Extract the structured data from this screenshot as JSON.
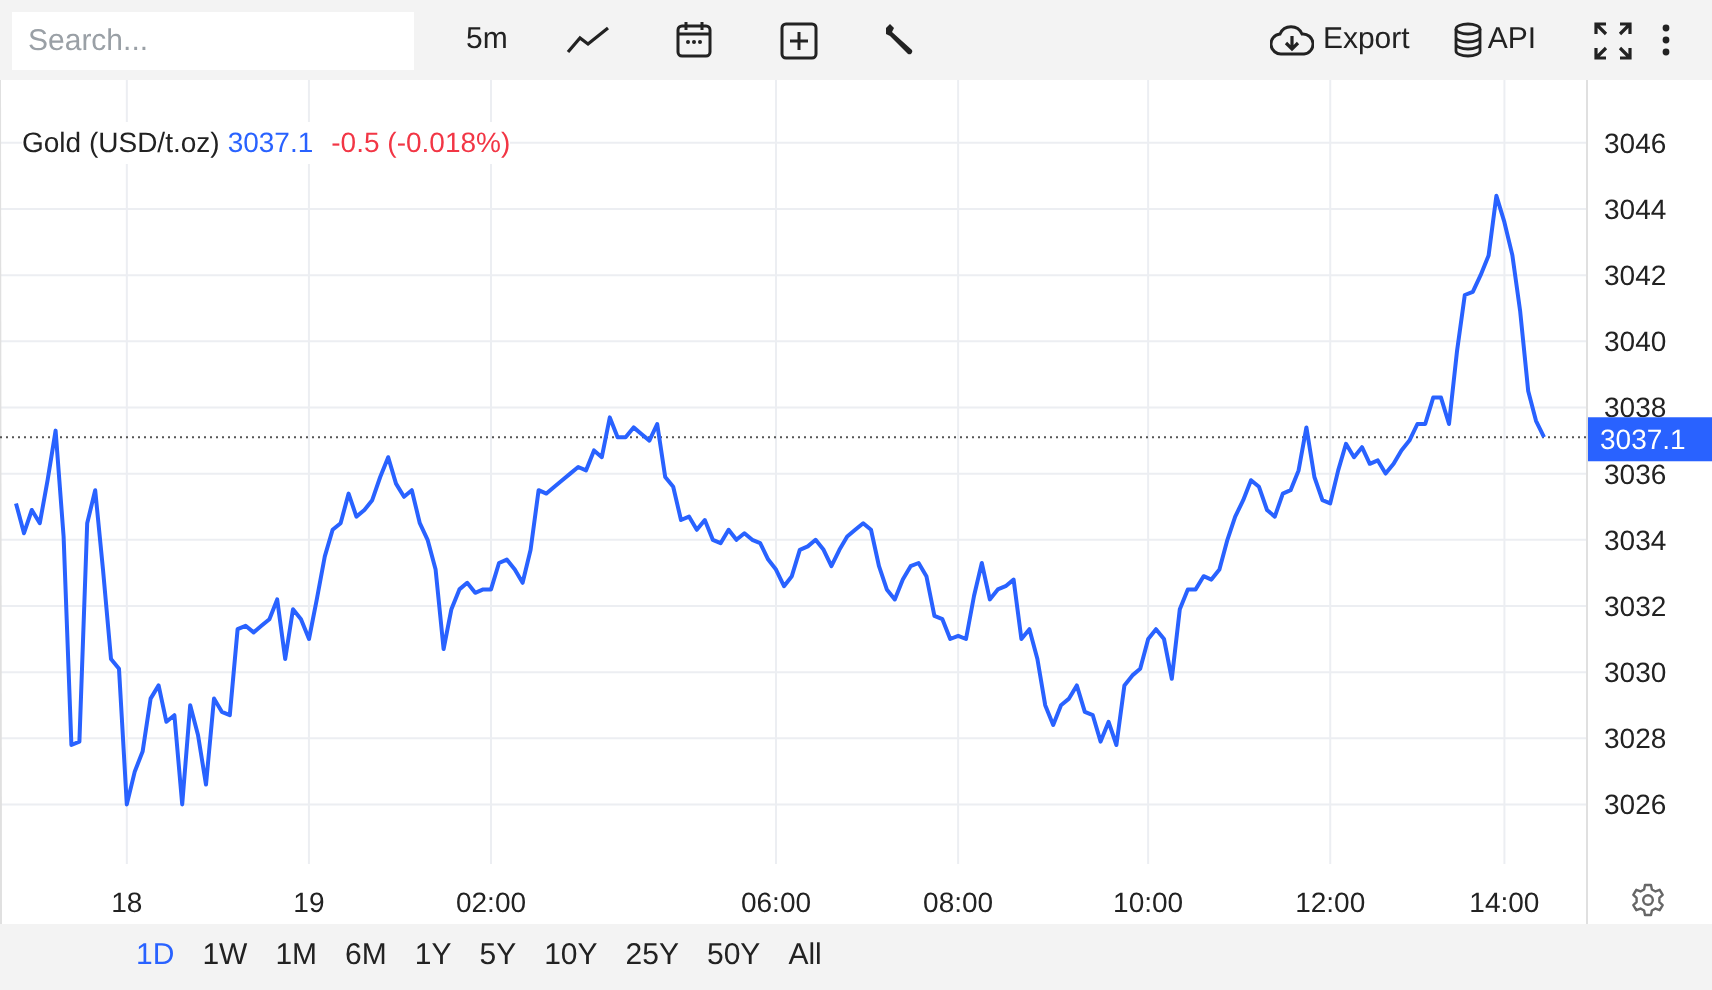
{
  "toolbar": {
    "search": {
      "placeholder": "Search..."
    },
    "interval": "5m",
    "export": "Export",
    "api": "API"
  },
  "chart": {
    "legend": {
      "price": "3037.1",
      "change": "-0.5 (-0.018%)"
    },
    "last_price": {
      "label": "3037.1"
    },
    "chart_data": {
      "type": "line",
      "grid": true,
      "categories": [
        null,
        null,
        null,
        null,
        null,
        null,
        null,
        null,
        null,
        null,
        null,
        null,
        null,
        null,
        "18",
        null,
        null,
        null,
        null,
        null,
        null,
        null,
        null,
        null,
        null,
        null,
        null,
        null,
        null,
        null,
        null,
        null,
        null,
        null,
        null,
        null,
        null,
        "19",
        null,
        null,
        null,
        null,
        null,
        null,
        null,
        null,
        null,
        null,
        null,
        null,
        null,
        null,
        null,
        null,
        null,
        null,
        null,
        null,
        null,
        null,
        "02:00",
        null,
        null,
        null,
        null,
        null,
        null,
        null,
        null,
        null,
        null,
        null,
        null,
        null,
        null,
        null,
        null,
        null,
        null,
        null,
        null,
        null,
        null,
        null,
        null,
        null,
        null,
        null,
        null,
        null,
        null,
        null,
        null,
        null,
        null,
        null,
        "06:00",
        null,
        null,
        null,
        null,
        null,
        null,
        null,
        null,
        null,
        null,
        null,
        null,
        null,
        null,
        null,
        null,
        null,
        null,
        null,
        null,
        null,
        null,
        "08:00",
        null,
        null,
        null,
        null,
        null,
        null,
        null,
        null,
        null,
        null,
        null,
        null,
        null,
        null,
        null,
        null,
        null,
        null,
        null,
        null,
        null,
        null,
        null,
        "10:00",
        null,
        null,
        null,
        null,
        null,
        null,
        null,
        null,
        null,
        null,
        null,
        null,
        null,
        null,
        null,
        null,
        null,
        null,
        null,
        null,
        null,
        null,
        "12:00",
        null,
        null,
        null,
        null,
        null,
        null,
        null,
        null,
        null,
        null,
        null,
        null,
        null,
        null,
        null,
        null,
        null,
        null,
        null,
        null,
        null,
        "14:00",
        null,
        null,
        null,
        null,
        null
      ],
      "ref_lines": [
        {
          "axis": "y",
          "value": 3037.1,
          "color": "#555555"
        }
      ],
      "series": [
        {
          "name": "Gold (USD/t.oz)",
          "color": "#2962ff",
          "values": [
            3035.1,
            3034.2,
            3034.9,
            3034.5,
            3035.8,
            3037.3,
            3034.1,
            3027.8,
            3027.9,
            3034.5,
            3035.5,
            3033.1,
            3030.4,
            3030.1,
            3026.0,
            3027.0,
            3027.6,
            3029.2,
            3029.6,
            3028.5,
            3028.7,
            3026.0,
            3029.0,
            3028.1,
            3026.6,
            3029.2,
            3028.8,
            3028.7,
            3031.3,
            3031.4,
            3031.2,
            3031.4,
            3031.6,
            3032.2,
            3030.4,
            3031.9,
            3031.6,
            3031.0,
            3032.2,
            3033.5,
            3034.3,
            3034.5,
            3035.4,
            3034.7,
            3034.9,
            3035.2,
            3035.9,
            3036.5,
            3035.7,
            3035.3,
            3035.5,
            3034.5,
            3034.0,
            3033.1,
            3030.7,
            3031.9,
            3032.5,
            3032.7,
            3032.4,
            3032.5,
            3032.5,
            3033.3,
            3033.4,
            3033.1,
            3032.7,
            3033.7,
            3035.5,
            3035.4,
            3035.6,
            3035.8,
            3036.0,
            3036.2,
            3036.1,
            3036.7,
            3036.5,
            3037.7,
            3037.1,
            3037.1,
            3037.4,
            3037.2,
            3037.0,
            3037.5,
            3035.9,
            3035.6,
            3034.6,
            3034.7,
            3034.3,
            3034.6,
            3034.0,
            3033.9,
            3034.3,
            3034.0,
            3034.2,
            3034.0,
            3033.9,
            3033.4,
            3033.1,
            3032.6,
            3032.9,
            3033.7,
            3033.8,
            3034.0,
            3033.7,
            3033.2,
            3033.7,
            3034.1,
            3034.3,
            3034.5,
            3034.3,
            3033.2,
            3032.5,
            3032.2,
            3032.8,
            3033.2,
            3033.3,
            3032.9,
            3031.7,
            3031.6,
            3031.0,
            3031.1,
            3031.0,
            3032.3,
            3033.3,
            3032.2,
            3032.5,
            3032.6,
            3032.8,
            3031.0,
            3031.3,
            3030.4,
            3029.0,
            3028.4,
            3029.0,
            3029.2,
            3029.6,
            3028.8,
            3028.7,
            3027.9,
            3028.5,
            3027.8,
            3029.6,
            3029.9,
            3030.1,
            3031.0,
            3031.3,
            3031.0,
            3029.8,
            3031.9,
            3032.5,
            3032.5,
            3032.9,
            3032.8,
            3033.1,
            3034.0,
            3034.7,
            3035.2,
            3035.8,
            3035.6,
            3034.9,
            3034.7,
            3035.4,
            3035.5,
            3036.1,
            3037.4,
            3035.9,
            3035.2,
            3035.1,
            3036.1,
            3036.9,
            3036.5,
            3036.8,
            3036.3,
            3036.4,
            3036.0,
            3036.3,
            3036.7,
            3037.0,
            3037.5,
            3037.5,
            3038.3,
            3038.3,
            3037.5,
            3039.7,
            3041.4,
            3041.5,
            3042.0,
            3042.6,
            3044.4,
            3043.6,
            3042.6,
            3040.9,
            3038.5,
            3037.6,
            3037.1
          ]
        }
      ],
      "ylim": [
        3024.2,
        3047.9
      ],
      "yticks": [
        3026,
        3028,
        3030,
        3032,
        3034,
        3036,
        3038,
        3040,
        3042,
        3044,
        3046
      ]
    }
  },
  "ranges": [
    {
      "label": "1D",
      "selected": true
    },
    {
      "label": "1W",
      "selected": false
    },
    {
      "label": "1M",
      "selected": false
    },
    {
      "label": "6M",
      "selected": false
    },
    {
      "label": "1Y",
      "selected": false
    },
    {
      "label": "5Y",
      "selected": false
    },
    {
      "label": "10Y",
      "selected": false
    },
    {
      "label": "25Y",
      "selected": false
    },
    {
      "label": "50Y",
      "selected": false
    },
    {
      "label": "All",
      "selected": false
    }
  ]
}
